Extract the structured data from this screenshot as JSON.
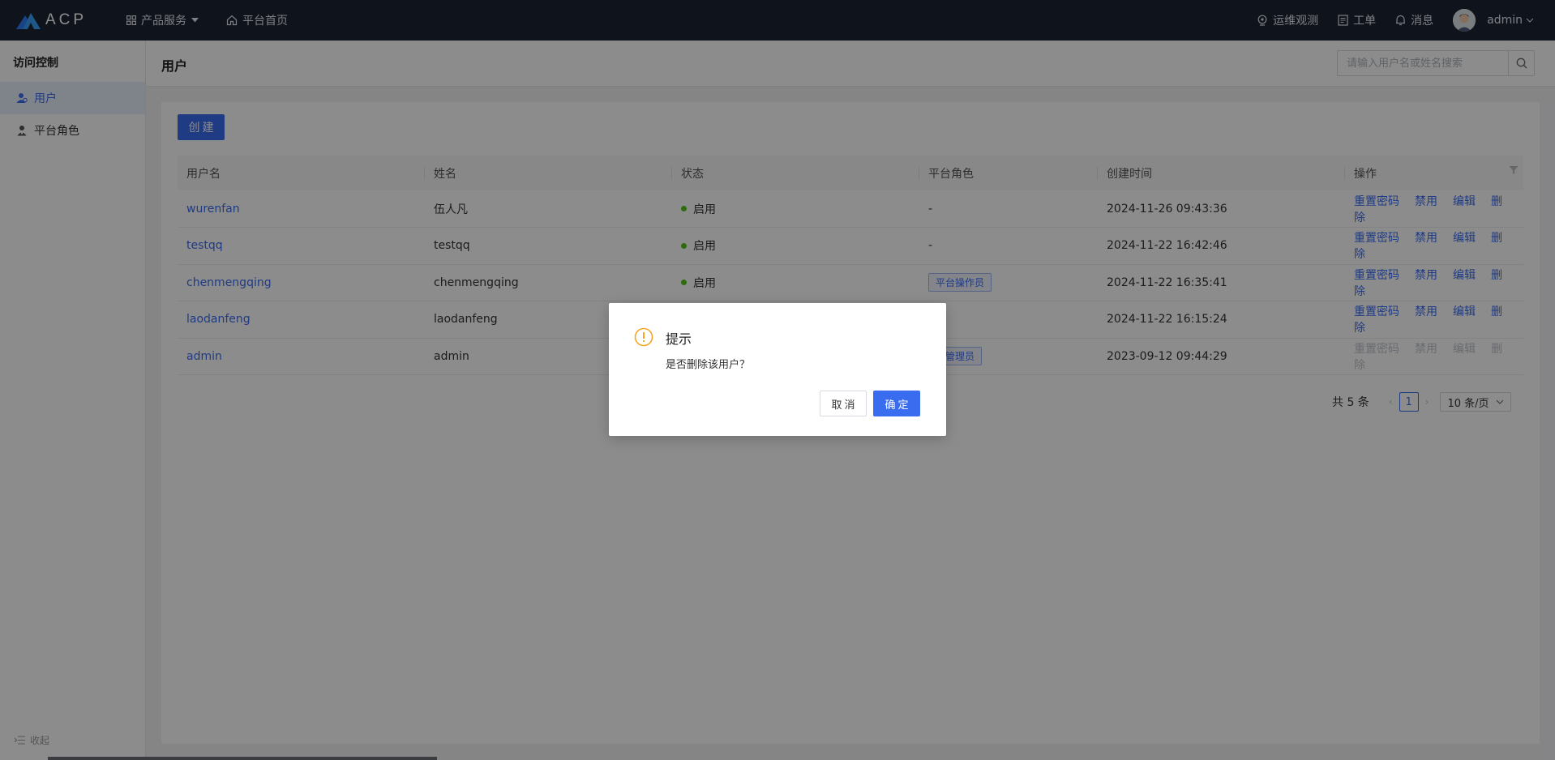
{
  "app": {
    "logo_text": "ACP"
  },
  "topnav": {
    "products_label": "产品服务",
    "home_label": "平台首页",
    "ops_label": "运维观测",
    "ticket_label": "工单",
    "message_label": "消息",
    "user_label": "admin"
  },
  "sidebar": {
    "title": "访问控制",
    "items": [
      {
        "label": "用户",
        "active": true
      },
      {
        "label": "平台角色",
        "active": false
      }
    ],
    "collapse_label": "收起"
  },
  "header": {
    "title": "用户",
    "search_placeholder": "请输入用户名或姓名搜索"
  },
  "main": {
    "create_label": "创建",
    "columns": [
      "用户名",
      "姓名",
      "状态",
      "平台角色",
      "创建时间",
      "操作"
    ],
    "rows": [
      {
        "username": "wurenfan",
        "name": "伍人凡",
        "status": "启用",
        "role": "-",
        "created": "2024-11-26 09:43:36"
      },
      {
        "username": "testqq",
        "name": "testqq",
        "status": "启用",
        "role": "-",
        "created": "2024-11-22 16:42:46"
      },
      {
        "username": "chenmengqing",
        "name": "chenmengqing",
        "status": "启用",
        "role": "平台操作员",
        "created": "2024-11-22 16:35:41"
      },
      {
        "username": "laodanfeng",
        "name": "laodanfeng",
        "status": "",
        "role": "",
        "created": "2024-11-22 16:15:24"
      },
      {
        "username": "admin",
        "name": "admin",
        "status": "",
        "role": "台管理员",
        "created": "2023-09-12 09:44:29"
      }
    ],
    "actions": [
      "重置密码",
      "禁用",
      "编辑",
      "删除"
    ],
    "status_color": "#52c41a",
    "pager": {
      "total": "共 5 条",
      "current": "1",
      "page_size": "10 条/页"
    }
  },
  "dialog": {
    "title": "提示",
    "message": "是否删除该用户？",
    "cancel_label": "取消",
    "ok_label": "确定",
    "warn_color": "#f5a623"
  },
  "colors": {
    "primary": "#3a6cf0",
    "topbar": "#1c2333"
  }
}
